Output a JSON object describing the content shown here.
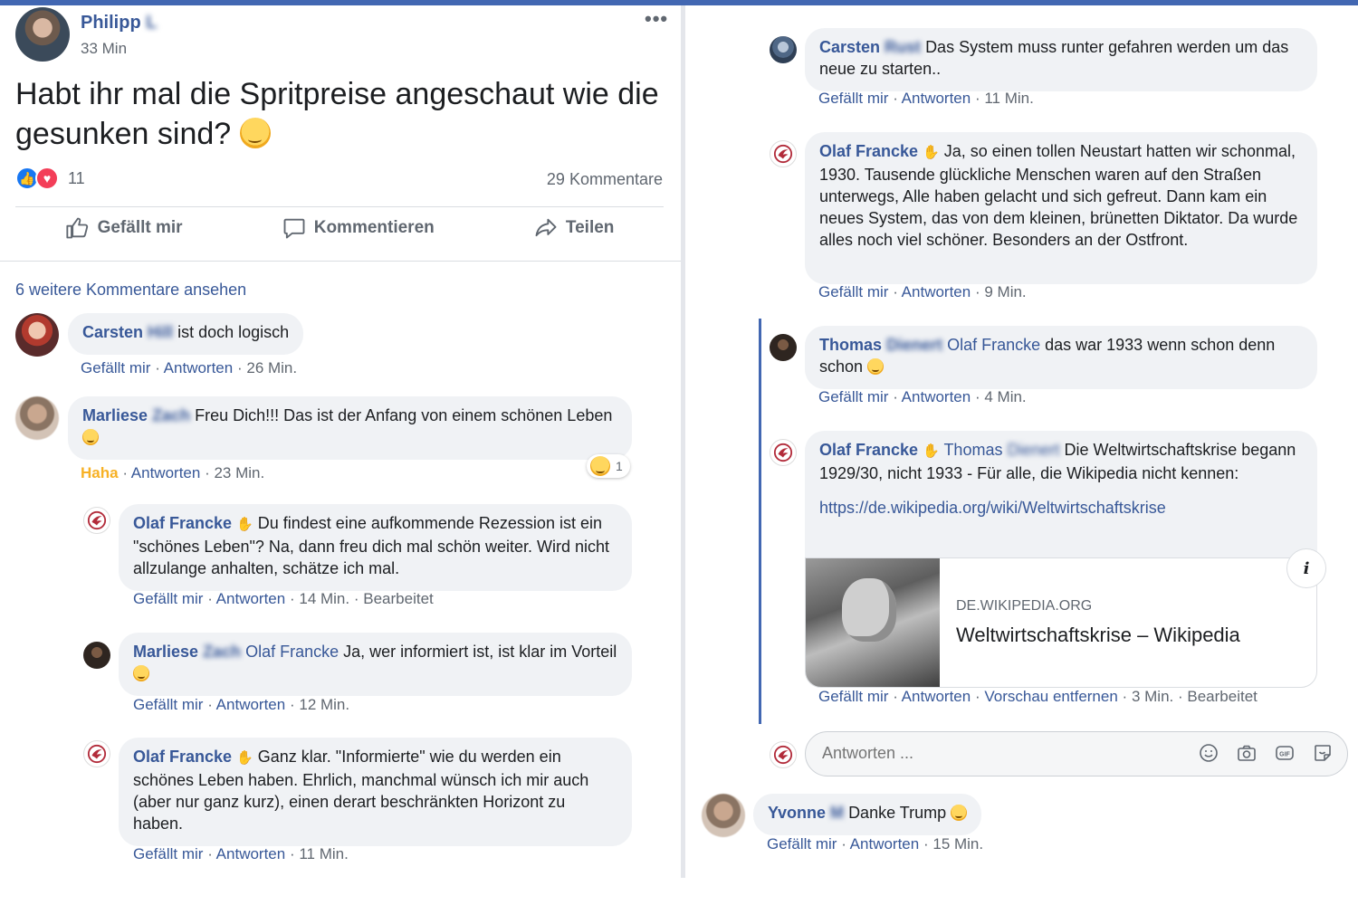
{
  "post": {
    "author_first": "Philipp",
    "author_last_blurred": "L",
    "time": "33 Min",
    "more": "•••",
    "text": "Habt ihr mal die Spritpreise angeschaut wie die gesunken sind?",
    "reaction_count": "11",
    "comment_count": "29 Kommentare",
    "actions": {
      "like": "Gefällt mir",
      "comment": "Kommentieren",
      "share": "Teilen"
    },
    "more_comments": "6 weitere Kommentare ansehen"
  },
  "labels": {
    "like": "Gefällt mir",
    "reply": "Antworten",
    "haha": "Haha",
    "edited": "Bearbeitet",
    "remove_preview": "Vorschau entfernen",
    "sep": "·"
  },
  "comments": [
    {
      "first": "Carsten",
      "last_blurred": "Hill",
      "text": "ist doch logisch",
      "time": "26 Min."
    },
    {
      "first": "Marliese",
      "last_blurred": "Zach",
      "text": "Freu Dich!!! Das ist der Anfang von einem schönen Leben",
      "time": "23 Min.",
      "reaction_count": "1"
    },
    {
      "first": "Olaf Francke",
      "text": "Du findest eine aufkommende Rezession ist ein \"schönes Leben\"? Na, dann freu dich mal schön weiter. Wird nicht allzulange anhalten, schätze ich mal.",
      "time": "14 Min."
    },
    {
      "first": "Marliese",
      "last_blurred": "Zach",
      "mention": "Olaf Francke",
      "text": "Ja, wer informiert ist, ist klar im Vorteil",
      "time": "12 Min."
    },
    {
      "first": "Olaf Francke",
      "text": "Ganz klar. \"Informierte\" wie du werden ein schönes Leben haben. Ehrlich, manchmal wünsch ich mir auch (aber nur ganz kurz), einen derart beschränkten Horizont zu haben.",
      "time": "11 Min."
    },
    {
      "first": "Carsten",
      "last_blurred": "Rust",
      "text": "Das System muss runter gefahren werden um das neue zu starten..",
      "time": "11 Min."
    },
    {
      "first": "Olaf Francke",
      "text": "Ja, so einen tollen Neustart hatten wir schonmal, 1930. Tausende glückliche Menschen waren auf den Straßen unterwegs, Alle haben gelacht und sich gefreut. Dann kam ein neues System, das von dem kleinen, brünetten Diktator. Da wurde alles noch viel schöner. Besonders an der Ostfront.",
      "time": "9 Min."
    },
    {
      "first": "Thomas",
      "last_blurred": "Dienert",
      "mention": "Olaf Francke",
      "text": "das war 1933 wenn schon denn schon",
      "time": "4 Min."
    },
    {
      "first": "Olaf Francke",
      "mention_first": "Thomas",
      "mention_blurred": "Dienert",
      "text": "Die Weltwirtschaftskrise begann 1929/30, nicht 1933 - Für alle, die Wikipedia nicht kennen:",
      "link": "https://de.wikipedia.org/wiki/Weltwirtschaftskrise",
      "time": "3 Min."
    },
    {
      "first": "Yvonne",
      "last_blurred": "M",
      "text": "Danke Trump",
      "time": "15 Min."
    }
  ],
  "preview": {
    "domain": "DE.WIKIPEDIA.ORG",
    "title": "Weltwirtschaftskrise – Wikipedia",
    "info": "i"
  },
  "reply_box": {
    "placeholder": "Antworten ..."
  },
  "colors": {
    "link": "#385898",
    "meta": "#606770",
    "bubble": "#f0f2f5",
    "haha": "#f7b125",
    "thread": "#4267b2"
  }
}
